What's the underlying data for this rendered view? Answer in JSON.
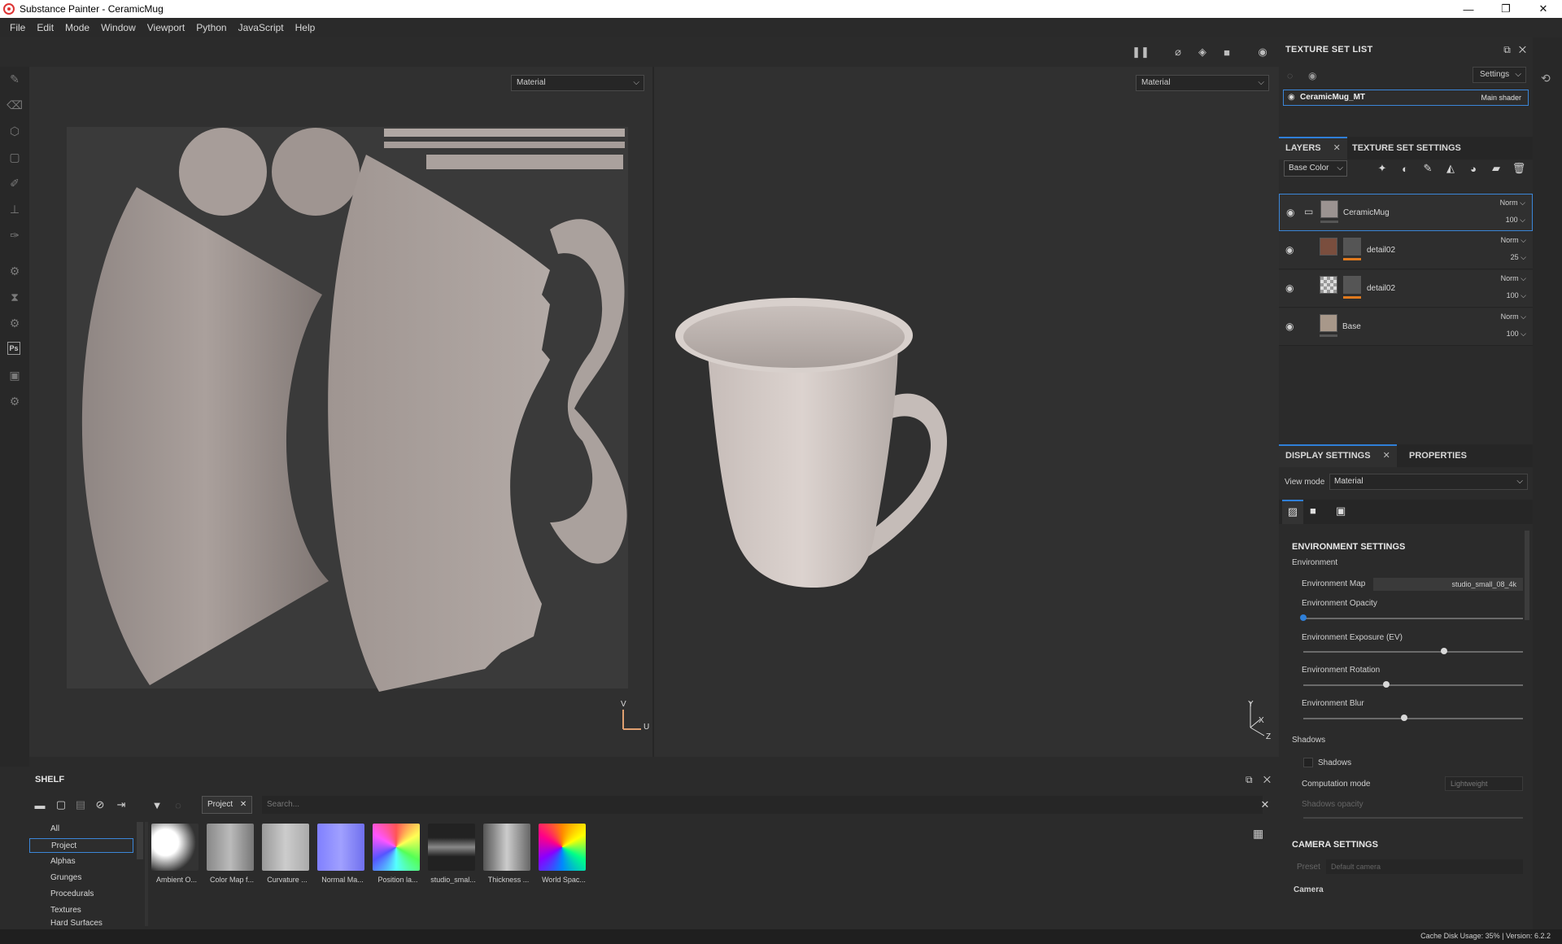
{
  "window": {
    "title": "Substance Painter - CeramicMug",
    "controls": [
      "—",
      "❐",
      "✕"
    ]
  },
  "menu": [
    "File",
    "Edit",
    "Mode",
    "Window",
    "Viewport",
    "Python",
    "JavaScript",
    "Help"
  ],
  "viewport": {
    "left_dropdown": "Material",
    "right_dropdown": "Material",
    "uv_axis_v": "V",
    "uv_axis_u": "U",
    "axis_y": "Y",
    "axis_x": "X",
    "axis_z": "Z"
  },
  "texture_set_list": {
    "title": "TEXTURE SET LIST",
    "settings_label": "Settings",
    "item_name": "CeramicMug_MT",
    "item_shader": "Main shader"
  },
  "layers_tabs": {
    "layers": "LAYERS",
    "texture_set_settings": "TEXTURE SET SETTINGS"
  },
  "channel_select": "Base Color",
  "layers": [
    {
      "name": "CeramicMug",
      "blend": "Norm",
      "opacity": "100",
      "type": "folder",
      "color": "#9b9391"
    },
    {
      "name": "detail02",
      "blend": "Norm",
      "opacity": "25",
      "type": "fill",
      "color": "#7a4e3e"
    },
    {
      "name": "detail02",
      "blend": "Norm",
      "opacity": "100",
      "type": "fill",
      "color": "#cccccc"
    },
    {
      "name": "Base",
      "blend": "Norm",
      "opacity": "100",
      "type": "fill",
      "color": "#a8988a"
    }
  ],
  "display_tabs": {
    "display_settings": "DISPLAY SETTINGS",
    "properties": "PROPERTIES"
  },
  "display": {
    "view_mode_label": "View mode",
    "view_mode_value": "Material",
    "env_section": "ENVIRONMENT SETTINGS",
    "env_group": "Environment",
    "env_map_label": "Environment Map",
    "env_map_value": "studio_small_08_4k",
    "env_opacity_label": "Environment Opacity",
    "env_opacity_value": 0.0,
    "env_exposure_label": "Environment Exposure (EV)",
    "env_exposure_value": 0.64,
    "env_rotation_label": "Environment Rotation",
    "env_rotation_value": 0.37,
    "env_blur_label": "Environment Blur",
    "env_blur_value": 0.45,
    "shadows_group": "Shadows",
    "shadows_checkbox": "Shadows",
    "computation_label": "Computation mode",
    "computation_value": "Lightweight",
    "shadows_opacity_label": "Shadows opacity",
    "camera_section": "CAMERA SETTINGS",
    "preset_label": "Preset",
    "preset_placeholder": "Default camera",
    "camera_group": "Camera"
  },
  "shelf": {
    "title": "SHELF",
    "project_chip": "Project",
    "search_placeholder": "Search...",
    "categories": [
      "All",
      "Project",
      "Alphas",
      "Grunges",
      "Procedurals",
      "Textures",
      "Hard Surfaces"
    ],
    "items": [
      {
        "label": "Ambient O...",
        "icon": "ambient-occlusion-map"
      },
      {
        "label": "Color Map f...",
        "icon": "color-map"
      },
      {
        "label": "Curvature ...",
        "icon": "curvature-map"
      },
      {
        "label": "Normal Ma...",
        "icon": "normal-map"
      },
      {
        "label": "Position la...",
        "icon": "position-map"
      },
      {
        "label": "studio_smal...",
        "icon": "environment-hdr"
      },
      {
        "label": "Thickness ...",
        "icon": "thickness-map"
      },
      {
        "label": "World Spac...",
        "icon": "world-space-normal-map"
      }
    ]
  },
  "status": "Cache Disk Usage:  35% | Version: 6.2.2"
}
